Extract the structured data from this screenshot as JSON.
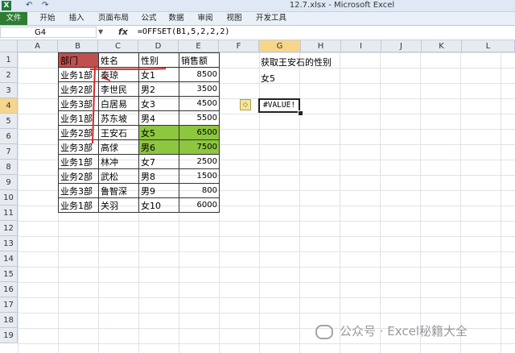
{
  "window": {
    "title": "12.7.xlsx - Microsoft Excel",
    "logo": "X",
    "quick_access": [
      "↶",
      "↷"
    ]
  },
  "ribbon_tabs": [
    "文件",
    "开始",
    "插入",
    "页面布局",
    "公式",
    "数据",
    "审阅",
    "视图",
    "开发工具"
  ],
  "formula_bar": {
    "name_box": "G4",
    "fx": "fx",
    "formula": "=OFFSET(B1,5,2,2,2)"
  },
  "columns": [
    "A",
    "B",
    "C",
    "D",
    "E",
    "F",
    "G",
    "H",
    "I",
    "J",
    "K",
    "L"
  ],
  "rows": [
    "1",
    "2",
    "3",
    "4",
    "5",
    "6",
    "7",
    "8",
    "9",
    "10",
    "11",
    "12",
    "13",
    "14",
    "15",
    "16",
    "17",
    "18",
    "19"
  ],
  "table": {
    "headers": [
      "部门",
      "姓名",
      "性别",
      "销售额"
    ],
    "rows": [
      [
        "业务1部",
        "秦琼",
        "女1",
        "8500"
      ],
      [
        "业务2部",
        "李世民",
        "男2",
        "3500"
      ],
      [
        "业务3部",
        "白居易",
        "女3",
        "4500"
      ],
      [
        "业务1部",
        "苏东坡",
        "男4",
        "5500"
      ],
      [
        "业务2部",
        "王安石",
        "女5",
        "6500"
      ],
      [
        "业务3部",
        "高俅",
        "男6",
        "7500"
      ],
      [
        "业务1部",
        "林冲",
        "女7",
        "2500"
      ],
      [
        "业务2部",
        "武松",
        "男8",
        "1500"
      ],
      [
        "业务3部",
        "鲁智深",
        "男9",
        "800"
      ],
      [
        "业务1部",
        "关羽",
        "女10",
        "6000"
      ]
    ]
  },
  "g_cells": {
    "g1": "获取王安石的性别",
    "g2": "女5",
    "g4": "#VALUE!"
  },
  "error_icon": "◇",
  "watermark": "公众号 · Excel秘籍大全",
  "colors": {
    "header_red": "#c0504d",
    "highlight_green": "#8dc63f",
    "annotation_red": "#d22a2a",
    "file_tab": "#2e7d32"
  }
}
